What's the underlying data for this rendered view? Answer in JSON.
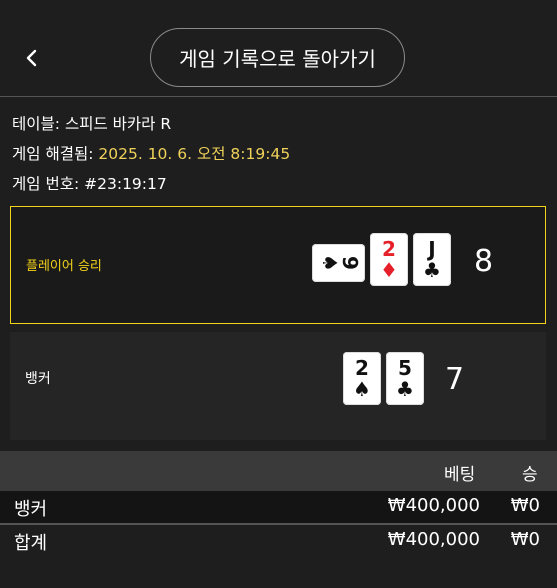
{
  "header": {
    "back_icon": "chevron-left-icon",
    "history_button": "게임 기록으로 돌아가기"
  },
  "info": {
    "table_label": "테이블:",
    "table_value": "스피드 바카라 R",
    "resolved_label": "게임 해결됨:",
    "resolved_value": "2025. 10. 6. 오전 8:19:45",
    "game_no_label": "게임 번호:",
    "game_no_value": "#23:19:17"
  },
  "player": {
    "label": "플레이어 승리",
    "total": "8",
    "cards": [
      {
        "rank": "9",
        "suit": "♠",
        "color": "black",
        "sideways": true
      },
      {
        "rank": "2",
        "suit": "♦",
        "color": "red",
        "sideways": false
      },
      {
        "rank": "J",
        "suit": "♣",
        "color": "black",
        "sideways": false
      }
    ]
  },
  "banker": {
    "label": "뱅커",
    "total": "7",
    "cards": [
      {
        "rank": "2",
        "suit": "♠",
        "color": "black",
        "sideways": false
      },
      {
        "rank": "5",
        "suit": "♣",
        "color": "black",
        "sideways": false
      }
    ]
  },
  "bets": {
    "col_bet": "베팅",
    "col_win": "승",
    "rows": [
      {
        "name": "뱅커",
        "bet": "₩400,000",
        "win": "₩0"
      }
    ],
    "total": {
      "name": "합계",
      "bet": "₩400,000",
      "win": "₩0"
    }
  },
  "colors": {
    "accent": "#f2d21b",
    "info_value": "#f0d25a",
    "background": "#1e1e1e",
    "red_suit": "#e5202a"
  }
}
